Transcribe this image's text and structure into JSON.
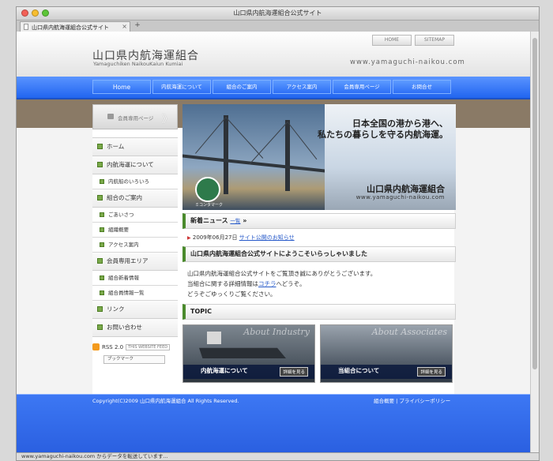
{
  "window": {
    "title": "山口県内航海運組合公式サイト",
    "tab_label": "山口県内航海運組合公式サイト",
    "tab_close": "×",
    "new_tab": "+",
    "status": "www.yamaguchi-naikou.com からデータを転送しています..."
  },
  "header": {
    "home_button": "HOME",
    "sitemap_button": "SITEMAP",
    "logo_jp": "山口県内航海運組合",
    "logo_en": "Yamaguchiken NaikouKaiun Kumiai",
    "url": "www.yamaguchi-naikou.com"
  },
  "nav": {
    "items": [
      "Home",
      "内航海運について",
      "組合のご案内",
      "アクセス案内",
      "会員専用ページ",
      "お問合せ"
    ]
  },
  "sidebar": {
    "member_button": "会員専用ページ",
    "member_arrow": "》",
    "menu": [
      {
        "label": "ホーム",
        "type": "main"
      },
      {
        "label": "内航海運について",
        "type": "main"
      },
      {
        "label": "内航船のいろいろ",
        "type": "sub"
      },
      {
        "label": "組合のご案内",
        "type": "main"
      },
      {
        "label": "ごあいさつ",
        "type": "sub"
      },
      {
        "label": "組織概要",
        "type": "sub"
      },
      {
        "label": "アクセス案内",
        "type": "sub"
      },
      {
        "label": "会員専用エリア",
        "type": "main"
      },
      {
        "label": "組合新着情報",
        "type": "sub"
      },
      {
        "label": "組合員情報一覧",
        "type": "sub"
      },
      {
        "label": "リンク",
        "type": "main"
      },
      {
        "label": "お問い合わせ",
        "type": "main"
      }
    ],
    "rss_label": "RSS 2.0",
    "rss_feed": "THIS WEBSITE FEED",
    "bookmark": "ブックマーク"
  },
  "hero": {
    "line1": "日本全国の港から港へ、",
    "line2": "私たちの暮らしを守る内航海運。",
    "title": "山口県内航海運組合",
    "url": "www.yamaguchi-naikou.com",
    "mascot_label": "ミコンタマーク"
  },
  "news": {
    "heading": "新着ニュース",
    "list_link": "一覧",
    "heading_arrow": "»",
    "items": [
      {
        "date": "2009年06月27日",
        "title": "サイト公開のお知らせ"
      }
    ]
  },
  "welcome": {
    "heading": "山口県内航海運組合公式サイトにようこそいらっしゃいました",
    "line1": "山口県内航海運組合公式サイトをご覧頂き誠にありがとうございます。",
    "line2_pre": "当組合に関する詳細情報は",
    "line2_link": "コチラ",
    "line2_post": "へどうぞ。",
    "line3": "どうぞごゆっくりご覧ください。"
  },
  "topic": {
    "heading": "TOPIC",
    "cards": [
      {
        "overlay": "About Industry",
        "caption": "内航海運について",
        "more": "詳細を見る"
      },
      {
        "overlay": "About Associates",
        "caption": "当組合について",
        "more": "詳細を見る"
      }
    ]
  },
  "footer": {
    "copyright": "Copyright(C)2009 山口県内航海運組合 All Rights Reserved.",
    "link1": "組合概要",
    "separator": "|",
    "link2": "プライバシーポリシー"
  },
  "colors": {
    "nav_blue": "#2d6ff6",
    "band_brown": "#8a7a66",
    "accent_green": "#4a8a2c"
  }
}
